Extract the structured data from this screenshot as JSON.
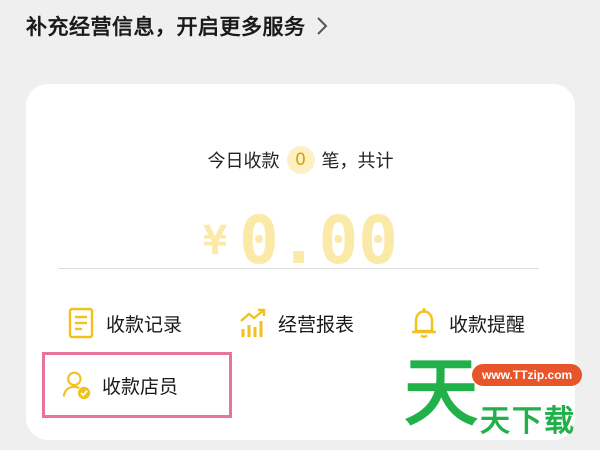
{
  "header": {
    "title": "补充经营信息，开启更多服务"
  },
  "summary": {
    "prefix": "今日收款",
    "count": "0",
    "suffix": "笔，共计",
    "currency": "¥",
    "amount": "0.00"
  },
  "menu": {
    "records": "收款记录",
    "reports": "经营报表",
    "alerts": "收款提醒",
    "staff": "收款店员"
  },
  "watermark": {
    "big": "天",
    "url": "www.TTzip.com",
    "small": "天下载"
  },
  "colors": {
    "accent": "#f3c11c",
    "amount_faded": "#fbe9a7",
    "highlight": "#e9739a",
    "watermark_green": "#22b04a",
    "watermark_orange": "#e8552a"
  }
}
